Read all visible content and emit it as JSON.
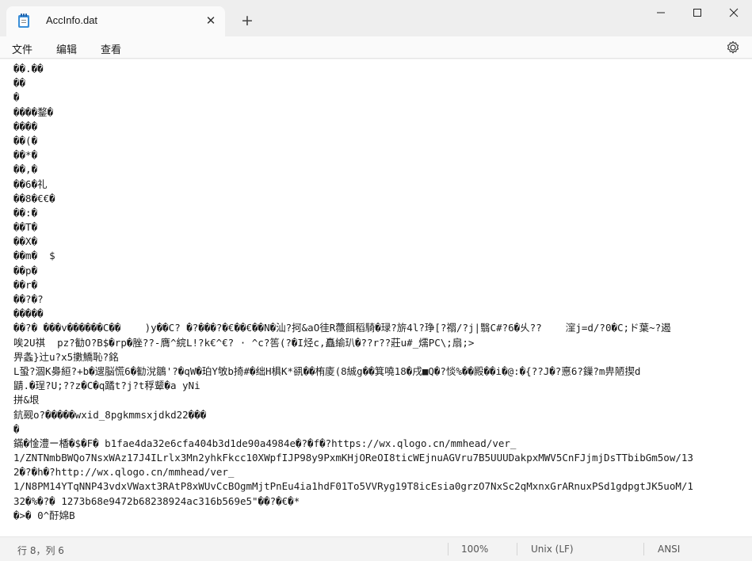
{
  "window": {
    "tab_title": "AccInfo.dat",
    "tab_close": "✕",
    "new_tab": "+",
    "icons": [
      "notepad-icon",
      "minimize-icon",
      "maximize-icon",
      "close-icon",
      "settings-icon"
    ]
  },
  "menu": {
    "file": "文件",
    "edit": "编辑",
    "view": "查看"
  },
  "editor": {
    "lines": [
      "��.��",
      "��",
      "�",
      "����鍪�",
      "����",
      "��(�",
      "��*�",
      "��,�",
      "��6�礼",
      "��8�€€�",
      "��:�",
      "��T�",
      "��X�",
      "��m�  $",
      "��p�",
      "��r�",
      "��?�?",
      "�����",
      "��?� ���v������C��    )y��C? �?���?�€��€��N�汕?抲&aO徍R蘉餌稻騎�琭?旂4l?琤[?禤/?j|翳C#?6�乆??    漥j=d/?0�C;ド葉~?遏",
      "唉2U祺  pz?勧O?B$�rp�脞??-膺^綄L!?k€^€? · ^c?筶(?�I烃c,矗緰玐�??r??莊u#_燸PC\\;扇;>",
      "畀螽}辻u?x5擻鱎恥?銘",
      "L蛩?涸K臱絙?+b�遚脳慌6�勧涗鶵'?�qW�珀Y敂b掎#�绌H椇K*谻��栯庱(8絾g��箕嘵18�戌■Q�?惔%��殿��i�@:�{??J�?悳6?鏁?m畁陋揳d",
      "鼱.�珵?U;??z�C�q蹫t?j?t稃颦�a yNi",
      "拼&垠",
      "鈧觋o?�����wxid_8pgkmmsxjdkd22���",
      "�",
      "鏋�惍澧ー楿�$�F� b1fae4da32e6cfa404b3d1de90a4984e�?�f�?https://wx.qlogo.cn/mmhead/ver_",
      "1/ZNTNmbBWQo7NsxWAz17J4ILrlx3Mn2yhkFkcc10XWpfIJP98y9PxmKHjOReOI8ticWEjnuAGVru7B5UUUDakpxMWV5CnFJjmjDsTTbibGm5ow/13",
      "2�?�h�?http://wx.qlogo.cn/mmhead/ver_",
      "1/N8PM14YTqNNP43vdxVWaxt3RAtP8xWUvCcBOgmMjtPnEu4ia1hdF01To5VVRyg19T8icEsia0grzO7NxSc2qMxnxGrARnuxPSd1gdpgtJK5uoM/1",
      "32�%�?� 1273b68e9472b68238924ac316b569e5\"��?�€�*",
      "�>� 0^酑婂B"
    ]
  },
  "status": {
    "position": "行 8，列 6",
    "zoom": "100%",
    "line_ending": "Unix (LF)",
    "encoding": "ANSI"
  }
}
